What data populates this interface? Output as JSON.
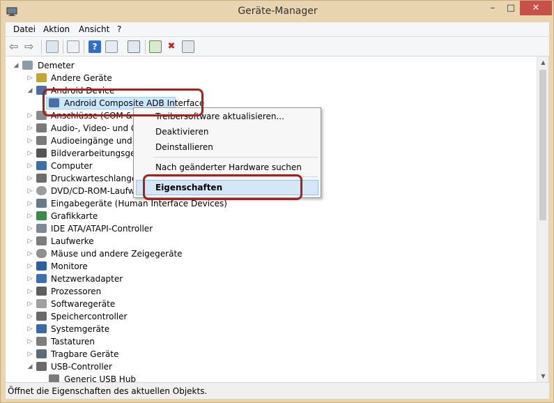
{
  "window": {
    "title": "Geräte-Manager",
    "minimize": "–",
    "maximize": "□",
    "close": "✕"
  },
  "menubar": {
    "items": [
      "Datei",
      "Aktion",
      "Ansicht",
      "?"
    ]
  },
  "tree": {
    "root": "Demeter",
    "rows": [
      "Andere Geräte",
      "Android Device",
      "Android Composite ADB Interface",
      "Anschlüsse (COM & LPT)",
      "Audio-, Video- und Ga",
      "Audioeingänge und -a",
      "Bildverarbeitungsgerä",
      "Computer",
      "Druckwarteschlangen",
      "DVD/CD-ROM-Laufwe",
      "Eingabegeräte (Human Interface Devices)",
      "Grafikkarte",
      "IDE ATA/ATAPI-Controller",
      "Laufwerke",
      "Mäuse und andere Zeigegeräte",
      "Monitore",
      "Netzwerkadapter",
      "Prozessoren",
      "Softwaregeräte",
      "Speichercontroller",
      "Systemgeräte",
      "Tastaturen",
      "Tragbare Geräte",
      "USB-Controller",
      "Generic USB Hub"
    ]
  },
  "context_menu": {
    "items": [
      "Treibersoftware aktualisieren...",
      "Deaktivieren",
      "Deinstallieren",
      "Nach geänderter Hardware suchen",
      "Eigenschaften"
    ]
  },
  "statusbar": {
    "text": "Öffnet die Eigenschaften des aktuellen Objekts."
  },
  "colors": {
    "highlight_marker": "#a8201a",
    "selection": "#cce8ff",
    "window_frame": "#e8d5b0"
  }
}
